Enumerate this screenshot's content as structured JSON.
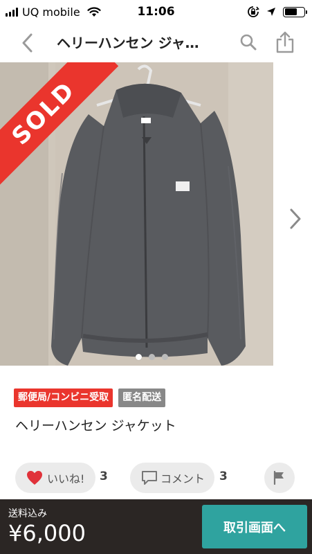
{
  "status_bar": {
    "carrier": "UQ mobile",
    "time": "11:06",
    "battery_level": 0.65,
    "icons": [
      "signal-icon",
      "wifi-icon",
      "rotation-lock-icon",
      "location-icon",
      "battery-icon"
    ]
  },
  "nav": {
    "title": "ヘリーハンセン ジャ…",
    "icons": [
      "back-chevron-icon",
      "search-icon",
      "share-icon"
    ]
  },
  "photo": {
    "sold_label": "SOLD",
    "slide_count": 3,
    "active_slide": 1,
    "icons": [
      "next-chevron-icon"
    ]
  },
  "tags": [
    "郵便局/コンビニ受取",
    "匿名配送"
  ],
  "item": {
    "title": "ヘリーハンセン ジャケット"
  },
  "actions": {
    "like_label": "いいね!",
    "like_count": "3",
    "comment_label": "コメント",
    "comment_count": "3",
    "icons": [
      "heart-icon",
      "comment-icon",
      "flag-icon"
    ]
  },
  "bottom": {
    "shipping_label": "送料込み",
    "price": "¥6,000",
    "purchase_label": "取引画面へ"
  },
  "colors": {
    "sold": "#ea352d",
    "tag_red": "#ea352d",
    "tag_gray": "#888888",
    "bottom_bar": "#2b2624",
    "purchase_button": "#2fa39f",
    "heart": "#e0323a"
  }
}
